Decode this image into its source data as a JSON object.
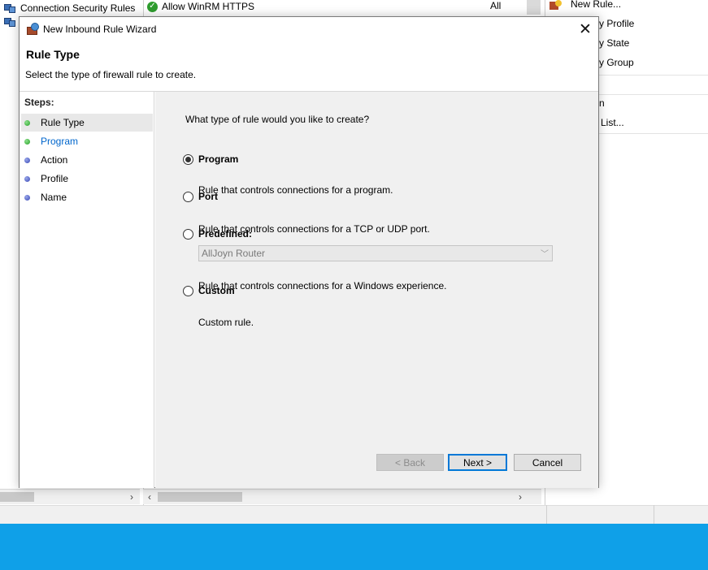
{
  "background": {
    "left_pane_items": [
      "Connection Security Rules"
    ],
    "rule_rows": [
      {
        "name": "Allow WinRM HTTPS",
        "profile": "All"
      }
    ],
    "actions": [
      "New Rule...",
      "...y Profile",
      "...y State",
      "...y Group",
      "...n",
      "... List..."
    ]
  },
  "dialog": {
    "title": "New Inbound Rule Wizard",
    "close_glyph": "✕",
    "header_title": "Rule Type",
    "header_subtitle": "Select the type of firewall rule to create.",
    "steps_title": "Steps:",
    "steps": [
      {
        "label": "Rule Type",
        "state": "done"
      },
      {
        "label": "Program",
        "state": "link"
      },
      {
        "label": "Action",
        "state": "pending"
      },
      {
        "label": "Profile",
        "state": "pending"
      },
      {
        "label": "Name",
        "state": "pending"
      }
    ],
    "question": "What type of rule would you like to create?",
    "options": [
      {
        "label": "Program",
        "desc": "Rule that controls connections for a program.",
        "checked": true
      },
      {
        "label": "Port",
        "desc": "Rule that controls connections for a TCP or UDP port.",
        "checked": false
      },
      {
        "label": "Predefined:",
        "desc": "Rule that controls connections for a Windows experience.",
        "checked": false
      },
      {
        "label": "Custom",
        "desc": "Custom rule.",
        "checked": false
      }
    ],
    "predefined_value": "AllJoyn Router",
    "buttons": {
      "back": "< Back",
      "next": "Next >",
      "cancel": "Cancel"
    }
  },
  "colors": {
    "taskbar": "#0fa0e8",
    "link": "#0066cc",
    "content_bg": "#f0f0f0"
  }
}
